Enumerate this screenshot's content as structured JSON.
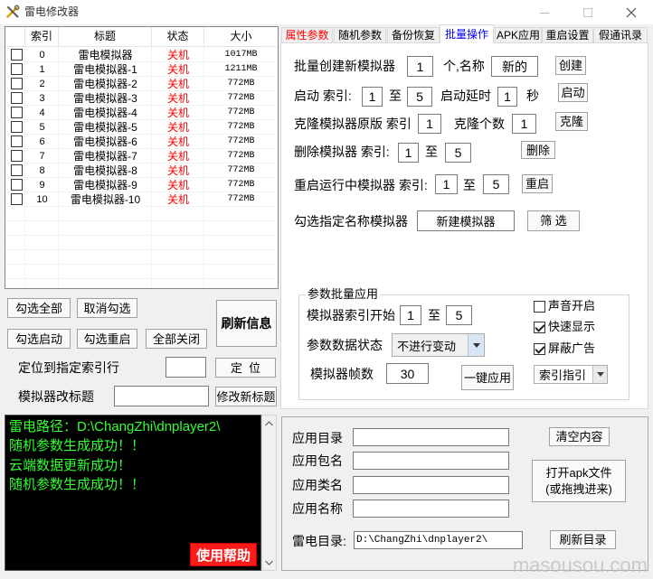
{
  "window": {
    "title": "雷电修改器"
  },
  "icons": {
    "app": "tools-icon",
    "minimize": "minimize-icon",
    "maximize": "maximize-icon",
    "close": "close-icon",
    "dropdown": "chevron-down-icon",
    "scroll_up": "scroll-up-icon",
    "scroll_down": "scroll-down-icon"
  },
  "colors": {
    "window_bg": "#f0f0f0",
    "status_off": "#ff0000",
    "console_bg": "#000000",
    "console_text": "#33ff33",
    "help_button_bg": "#ff1a1a",
    "help_button_text": "#ffffff"
  },
  "emulator_list": {
    "columns": [
      "索引",
      "标题",
      "状态",
      "大小"
    ],
    "rows": [
      {
        "checked": false,
        "index": "0",
        "title": "雷电模拟器",
        "status": "关机",
        "size": "1017MB"
      },
      {
        "checked": false,
        "index": "1",
        "title": "雷电模拟器-1",
        "status": "关机",
        "size": "1211MB"
      },
      {
        "checked": false,
        "index": "2",
        "title": "雷电模拟器-2",
        "status": "关机",
        "size": "772MB"
      },
      {
        "checked": false,
        "index": "3",
        "title": "雷电模拟器-3",
        "status": "关机",
        "size": "772MB"
      },
      {
        "checked": false,
        "index": "4",
        "title": "雷电模拟器-4",
        "status": "关机",
        "size": "772MB"
      },
      {
        "checked": false,
        "index": "5",
        "title": "雷电模拟器-5",
        "status": "关机",
        "size": "772MB"
      },
      {
        "checked": false,
        "index": "6",
        "title": "雷电模拟器-6",
        "status": "关机",
        "size": "772MB"
      },
      {
        "checked": false,
        "index": "7",
        "title": "雷电模拟器-7",
        "status": "关机",
        "size": "772MB"
      },
      {
        "checked": false,
        "index": "8",
        "title": "雷电模拟器-8",
        "status": "关机",
        "size": "772MB"
      },
      {
        "checked": false,
        "index": "9",
        "title": "雷电模拟器-9",
        "status": "关机",
        "size": "772MB"
      },
      {
        "checked": false,
        "index": "10",
        "title": "雷电模拟器-10",
        "status": "关机",
        "size": "772MB"
      }
    ]
  },
  "list_actions": {
    "select_all": "勾选全部",
    "deselect_all": "取消勾选",
    "refresh": "刷新信息",
    "start_checked": "勾选启动",
    "restart_checked": "勾选重启",
    "close_all": "全部关闭"
  },
  "locate": {
    "label": "定位到指定索引行",
    "value": "",
    "button": "定  位"
  },
  "rename": {
    "label": "模拟器改标题",
    "value": "",
    "button": "修改新标题"
  },
  "console": {
    "lines": [
      "雷电路径：D:\\ChangZhi\\dnplayer2\\",
      "随机参数生成成功！！",
      "云端数据更新成功！",
      "随机参数生成成功！！"
    ],
    "help_button": "使用帮助"
  },
  "tabs": [
    {
      "label": "属性参数",
      "color": "#ff0000",
      "selected": false
    },
    {
      "label": "随机参数",
      "color": "#000000",
      "selected": false
    },
    {
      "label": "备份恢复",
      "color": "#000000",
      "selected": false
    },
    {
      "label": "批量操作",
      "color": "#0000ff",
      "selected": true
    },
    {
      "label": "APK应用",
      "color": "#000000",
      "selected": false
    },
    {
      "label": "重启设置",
      "color": "#000000",
      "selected": false
    },
    {
      "label": "假通讯录",
      "color": "#000000",
      "selected": false
    }
  ],
  "batch": {
    "create": {
      "label": "批量创建新模拟器",
      "count": "1",
      "name_label": "个,名称",
      "name": "新的",
      "button": "创建"
    },
    "start": {
      "label": "启动 索引:",
      "from": "1",
      "to_label": "至",
      "to": "5",
      "delay_label": "启动延时",
      "delay": "1",
      "unit": "秒",
      "button": "启动"
    },
    "clone": {
      "label": "克隆模拟器原版 索引",
      "index": "1",
      "count_label": "克隆个数",
      "count": "1",
      "button": "克隆"
    },
    "delete": {
      "label": "删除模拟器 索引:",
      "from": "1",
      "to_label": "至",
      "to": "5",
      "button": "删除"
    },
    "restart": {
      "label": "重启运行中模拟器 索引:",
      "from": "1",
      "to_label": "至",
      "to": "5",
      "button": "重启"
    },
    "filter": {
      "label": "勾选指定名称模拟器",
      "name": "新建模拟器",
      "button": "筛 选"
    }
  },
  "param_apply": {
    "title": "参数批量应用",
    "range_label": "模拟器索引开始",
    "from": "1",
    "to_label": "至",
    "to": "5",
    "state_label": "参数数据状态",
    "state": "不进行变动",
    "fps_label": "模拟器帧数",
    "fps": "30",
    "apply_button": "一键应用",
    "options": [
      {
        "label": "声音开启",
        "checked": false
      },
      {
        "label": "快速显示",
        "checked": true
      },
      {
        "label": "屏蔽广告",
        "checked": true
      }
    ],
    "index_guide": "索引指引"
  },
  "apk": {
    "dir_label": "应用目录",
    "dir": "",
    "package_label": "应用包名",
    "package": "",
    "class_label": "应用类名",
    "class": "",
    "name_label": "应用名称",
    "name": "",
    "clear_button": "清空内容",
    "open_button_line1": "打开apk文件",
    "open_button_line2": "(或拖拽进来)",
    "ld_dir_label": "雷电目录:",
    "ld_dir": "D:\\ChangZhi\\dnplayer2\\",
    "refresh_button": "刷新目录"
  },
  "watermark": "masousou.com"
}
